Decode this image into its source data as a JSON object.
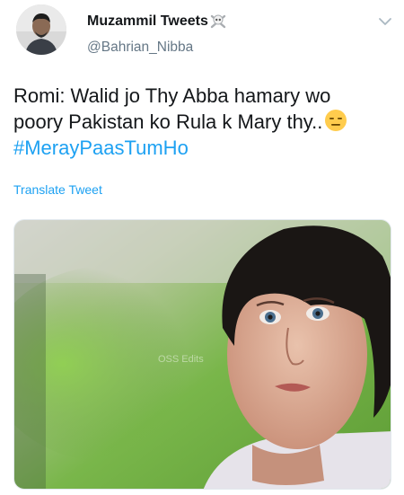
{
  "tweet": {
    "display_name": "Muzammil Tweets",
    "display_name_emoji": "skull-and-crossbones-icon",
    "username": "@Bahrian_Nibba",
    "text_line1": "Romi: Walid jo Thy Abba hamary wo",
    "text_line2": "poory Pakistan ko Rula k Mary thy..",
    "text_emoji": "expressionless-face-icon",
    "hashtag": "#MerayPaasTumHo",
    "translate_label": "Translate Tweet",
    "media_watermark": "OSS Edits"
  },
  "colors": {
    "accent": "#1da1f2",
    "text_primary": "#14171a",
    "text_secondary": "#657786"
  },
  "icons": {
    "menu": "chevron-down-icon",
    "avatar": "profile-avatar"
  }
}
